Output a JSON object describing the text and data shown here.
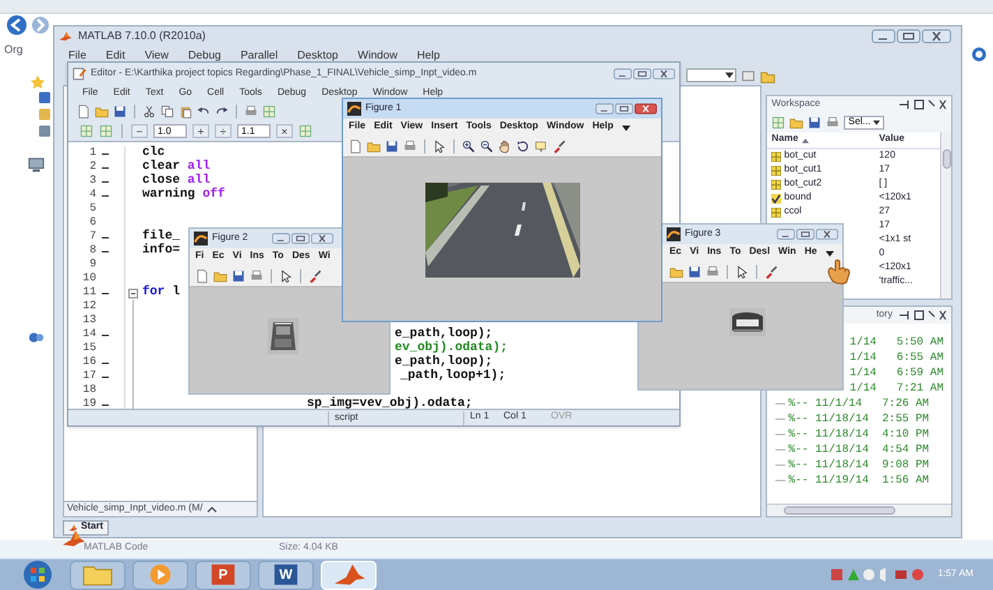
{
  "explorer": {
    "nav_label": "Org",
    "file_type": "MATLAB Code",
    "file_size": "Size: 4.04 KB"
  },
  "matlab": {
    "title": "MATLAB 7.10.0 (R2010a)",
    "menu": [
      "File",
      "Edit",
      "View",
      "Debug",
      "Parallel",
      "Desktop",
      "Window",
      "Help"
    ],
    "folder_footer": "Vehicle_simp_Inpt_video.m (M/",
    "start_button": "Start"
  },
  "editor": {
    "title": "Editor - E:\\Karthika project topics Regarding\\Phase_1_FINAL\\Vehicle_simp_Inpt_video.m",
    "menu": [
      "File",
      "Edit",
      "Text",
      "Go",
      "Cell",
      "Tools",
      "Debug",
      "Desktop",
      "Window",
      "Help"
    ],
    "cell_toolbar": [
      {
        "kind": "button",
        "text": "−"
      },
      {
        "kind": "field",
        "text": "1.0"
      },
      {
        "kind": "button",
        "text": "+"
      },
      {
        "kind": "button",
        "text": "÷"
      },
      {
        "kind": "field",
        "text": "1.1"
      },
      {
        "kind": "button",
        "text": "×"
      }
    ],
    "lines": [
      {
        "number": "1",
        "executable": true,
        "code": [
          {
            "kind": "plain",
            "text": "clc"
          }
        ]
      },
      {
        "number": "2",
        "executable": true,
        "code": [
          {
            "kind": "plain",
            "text": "clear "
          },
          {
            "kind": "string",
            "text": "all"
          }
        ]
      },
      {
        "number": "3",
        "executable": true,
        "code": [
          {
            "kind": "plain",
            "text": "close "
          },
          {
            "kind": "string",
            "text": "all"
          }
        ]
      },
      {
        "number": "4",
        "executable": true,
        "code": [
          {
            "kind": "plain",
            "text": "warning "
          },
          {
            "kind": "string",
            "text": "off"
          }
        ]
      },
      {
        "number": "5",
        "executable": false
      },
      {
        "number": "6",
        "executable": false
      },
      {
        "number": "7",
        "executable": true,
        "code": [
          {
            "kind": "plain",
            "text": "file_"
          }
        ]
      },
      {
        "number": "8",
        "executable": true,
        "code": [
          {
            "kind": "plain",
            "text": "info="
          }
        ]
      },
      {
        "number": "9",
        "executable": false
      },
      {
        "number": "10",
        "executable": false
      },
      {
        "number": "11",
        "executable": true,
        "fold": true,
        "code": [
          {
            "kind": "keyword",
            "text": "for"
          },
          {
            "kind": "plain",
            "text": " l"
          }
        ]
      },
      {
        "number": "12",
        "executable": false
      },
      {
        "number": "13",
        "executable": false
      },
      {
        "number": "14",
        "executable": true,
        "code": [
          {
            "kind": "plain",
            "text": "e_path,loop);"
          }
        ]
      },
      {
        "number": "15",
        "executable": false,
        "code": [
          {
            "kind": "comment",
            "text": "ev_obj).odata);"
          }
        ]
      },
      {
        "number": "16",
        "executable": true,
        "code": [
          {
            "kind": "plain",
            "text": "e_path,loop);"
          }
        ]
      },
      {
        "number": "17",
        "executable": true,
        "code": [
          {
            "kind": "plain",
            "text": "_path,loop+1);"
          }
        ]
      },
      {
        "number": "18",
        "executable": false
      },
      {
        "number": "19",
        "executable": true,
        "code": [
          {
            "kind": "plain",
            "text": "sp_img=vev_obj).odata;"
          }
        ]
      }
    ],
    "status": {
      "mode": "script",
      "line": "Ln 1",
      "column": "Col 1",
      "overwrite": "OVR"
    }
  },
  "figures": [
    {
      "title": "Figure 1",
      "active": true,
      "menu": [
        "File",
        "Edit",
        "View",
        "Insert",
        "Tools",
        "Desktop",
        "Window",
        "Help"
      ],
      "overflow": true
    },
    {
      "title": "Figure 2",
      "active": false,
      "menu": [
        "Fi",
        "Ec",
        "Vi",
        "Ins",
        "To",
        "Des",
        "Wi"
      ],
      "overflow": false
    },
    {
      "title": "Figure 3",
      "active": false,
      "menu": [
        "Ec",
        "Vi",
        "Ins",
        "To",
        "Desl",
        "Win",
        "He"
      ],
      "overflow": true
    }
  ],
  "workspace": {
    "title": "Workspace",
    "select_label": "Sel...",
    "columns": [
      "Name",
      "Value"
    ],
    "rows": [
      {
        "name": "bot_cut",
        "value": "120",
        "kind": "matrix"
      },
      {
        "name": "bot_cut1",
        "value": "17",
        "kind": "matrix"
      },
      {
        "name": "bot_cut2",
        "value": "[ ]",
        "kind": "matrix"
      },
      {
        "name": "bound",
        "value": "<120x1",
        "kind": "logical"
      },
      {
        "name": "ccol",
        "value": "27",
        "kind": "matrix"
      },
      {
        "value": "17"
      },
      {
        "value": "<1x1 st"
      },
      {
        "value": "0"
      },
      {
        "value": "<120x1"
      },
      {
        "value": "'traffic..."
      }
    ]
  },
  "history": {
    "title": "tory",
    "entries": [
      {
        "kind": "clipped",
        "text": "1/14   5:50 AM"
      },
      {
        "kind": "clipped",
        "text": "1/14   6:55 AM"
      },
      {
        "kind": "clipped",
        "text": "1/14   6:59 AM"
      },
      {
        "kind": "clipped",
        "text": "1/14   7:21 AM"
      },
      {
        "kind": "full",
        "text": "%-- 11/1/14   7:26 AM"
      },
      {
        "kind": "full",
        "text": "%-- 11/18/14  2:55 PM"
      },
      {
        "kind": "full",
        "text": "%-- 11/18/14  4:10 PM"
      },
      {
        "kind": "full",
        "text": "%-- 11/18/14  4:54 PM"
      },
      {
        "kind": "full",
        "text": "%-- 11/18/14  9:08 PM"
      },
      {
        "kind": "full",
        "text": "%-- 11/19/14  1:56 AM"
      }
    ]
  },
  "taskbar": {
    "apps": [
      {
        "kind": "explorer",
        "selected": false
      },
      {
        "kind": "media",
        "selected": false
      },
      {
        "kind": "powerpoint",
        "letter": "P",
        "selected": false
      },
      {
        "kind": "word",
        "letter": "W",
        "selected": false
      },
      {
        "kind": "matlab",
        "selected": true
      }
    ],
    "clock": "1:57 AM"
  }
}
